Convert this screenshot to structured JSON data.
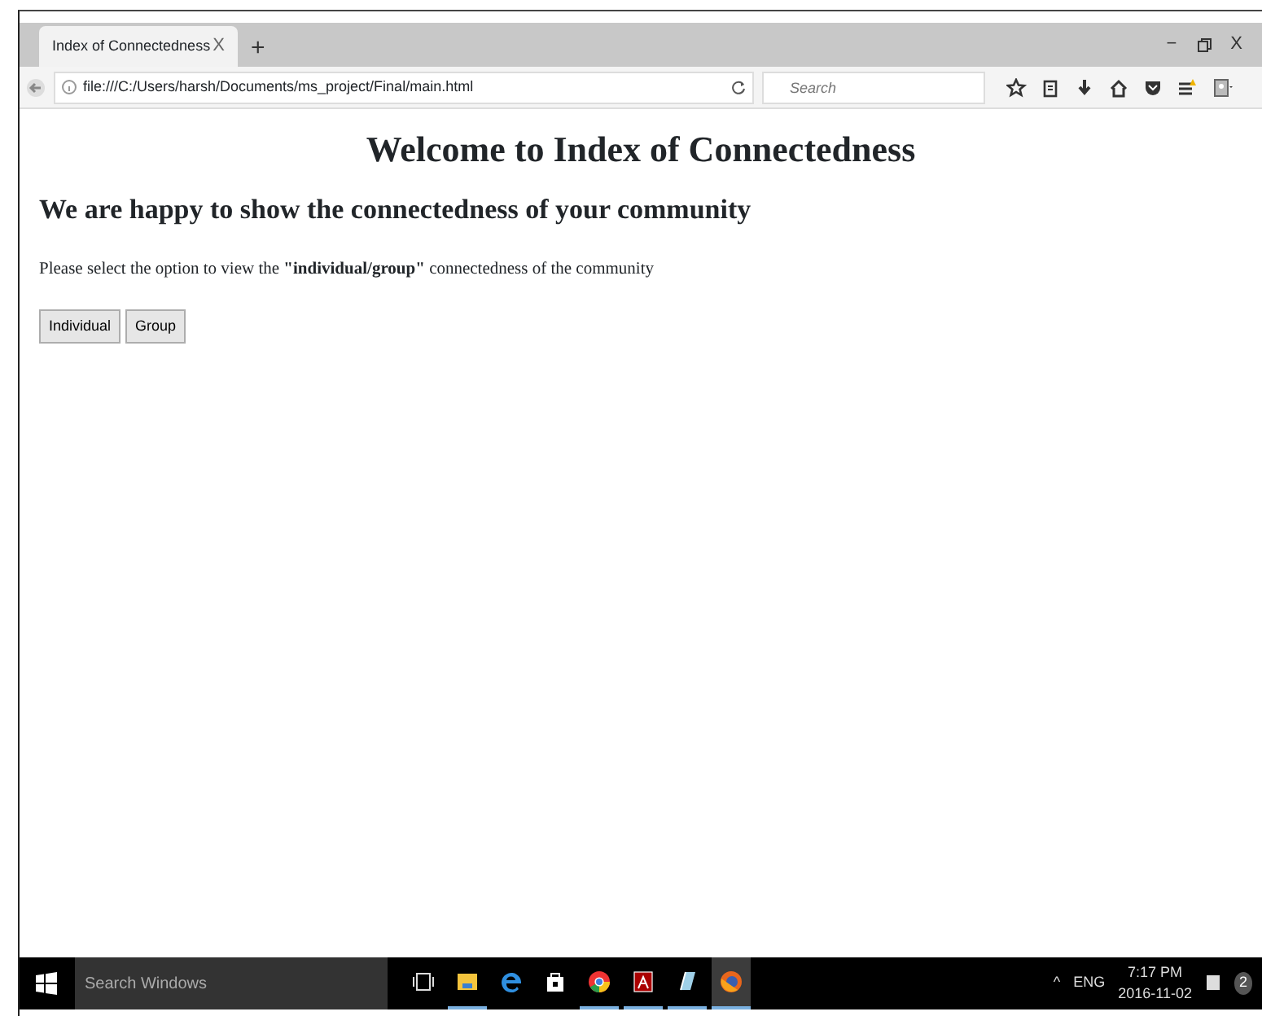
{
  "browser": {
    "tab": {
      "title": "Index of Connectedness",
      "close": "X",
      "new_tab": "+"
    },
    "window_controls": [
      "−",
      "X"
    ],
    "address": "file:///C:/Users/harsh/Documents/ms_project/Final/main.html",
    "search": {
      "placeholder": "Search"
    }
  },
  "page": {
    "title": "Welcome to Index of Connectedness",
    "subtitle": "We are happy to show the connectedness of your community",
    "prompt": "Please select the option to view the **\"individual/group\"** connectedness of the community",
    "buttons": [
      "Individual",
      "Group"
    ]
  },
  "taskbar": {
    "search": {
      "placeholder": "Search Windows"
    },
    "apps": [
      {
        "kind": "taskview",
        "running": false,
        "active": false
      },
      {
        "kind": "folder",
        "running": true,
        "active": false
      },
      {
        "kind": "edge",
        "running": false,
        "active": false
      },
      {
        "kind": "store",
        "running": false,
        "active": false
      },
      {
        "kind": "chrome",
        "running": true,
        "active": false
      },
      {
        "kind": "pdf",
        "running": true,
        "active": false
      },
      {
        "kind": "notes",
        "running": true,
        "active": false
      },
      {
        "kind": "firefox",
        "running": true,
        "active": true
      }
    ],
    "chevron": "^",
    "language": "ENG",
    "time": "7:17 PM",
    "date": "2016-11-02",
    "notifications": "2"
  }
}
